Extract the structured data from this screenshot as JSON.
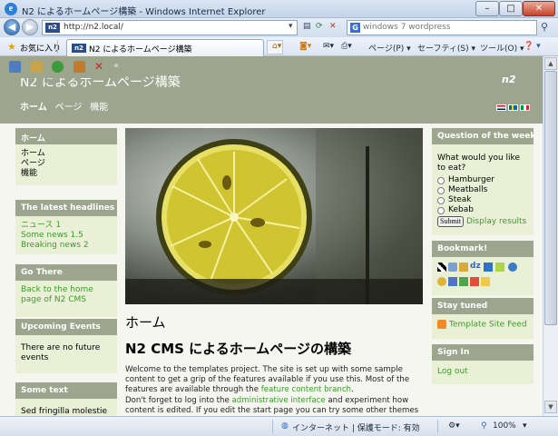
{
  "window": {
    "title": "N2 によるホームページ構築 - Windows Internet Explorer",
    "minimize": "–",
    "maximize": "□",
    "close": "✕"
  },
  "address_bar": {
    "url": "http://n2.local/",
    "favicon_text": "n2",
    "search_value": "windows 7 wordpress",
    "search_engine_icon": "G"
  },
  "favorites_bar": {
    "favorites_label": "お気に入り",
    "tab_title": "N2 によるホームページ構築"
  },
  "command_bar": {
    "page": "ページ(P) ▾",
    "safety": "セーフティ(S) ▾",
    "tools": "ツール(O) ▾",
    "help": "❓ ▾"
  },
  "site": {
    "title": "N2 によるホームページ構築",
    "logo": "n2",
    "nav": [
      "ホーム",
      "ページ",
      "機能"
    ]
  },
  "left": {
    "home_box": {
      "title": "ホーム",
      "items": [
        "ホーム",
        "ページ",
        "機能"
      ]
    },
    "headlines_box": {
      "title": "The latest headlines",
      "items": [
        "ニュース 1",
        "Some news 1.5",
        "Breaking news 2"
      ]
    },
    "gothere_box": {
      "title": "Go There",
      "link": "Back to the home page of N2 CMS"
    },
    "events_box": {
      "title": "Upcoming Events",
      "text": "There are no future events"
    },
    "sometext_box": {
      "title": "Some text",
      "text": "Sed fringilla molestie"
    }
  },
  "main": {
    "heading": "ホーム",
    "subheading": "N2 CMS によるホームページの構築",
    "p1_a": "Welcome to the templates project. The site is set up with some sample content to get a grip of the features available if you use this. Most of the features are available through the ",
    "p1_link": "feature content branch",
    "p1_b": ".",
    "p2_a": "Don't forget to log into the ",
    "p2_link": "administrative interface",
    "p2_b": " and experiment how content is edited. If you edit the start page you can try some other themes as well."
  },
  "right": {
    "poll": {
      "title": "Question of the week",
      "question": "What would you like to eat?",
      "options": [
        "Hamburger",
        "Meatballs",
        "Steak",
        "Kebab"
      ],
      "submit": "Submit",
      "results_link": "Display results"
    },
    "bookmark": {
      "title": "Bookmark!"
    },
    "staytuned": {
      "title": "Stay tuned",
      "feed_link": "Template Site Feed"
    },
    "signin": {
      "title": "Sign In",
      "link": "Log out"
    }
  },
  "status_bar": {
    "zone": "インターネット | 保護モード: 有効",
    "zoom": "100%"
  },
  "colors": {
    "header_olive": "#9ea58e",
    "box_bg": "#eaf0d6",
    "link_green": "#3d9a2e"
  }
}
